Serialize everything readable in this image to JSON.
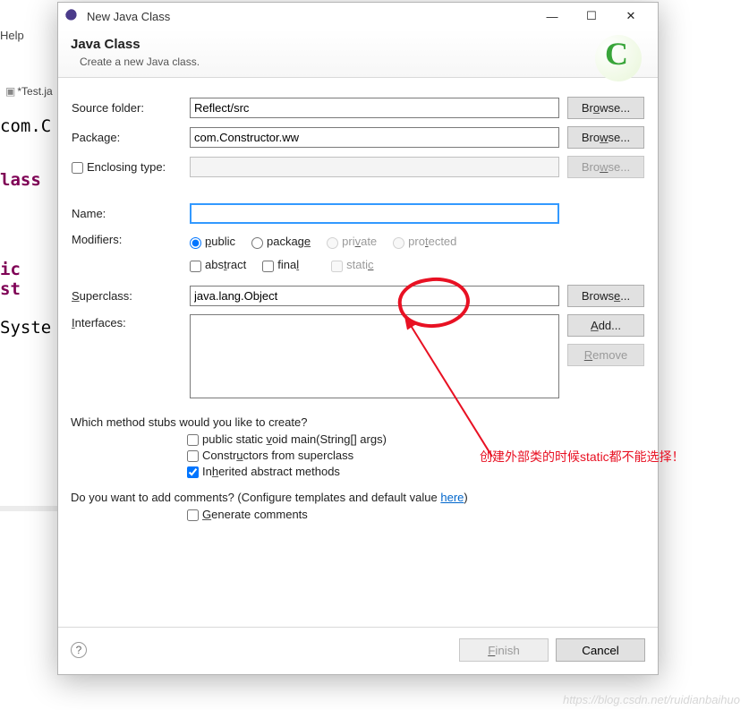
{
  "bg": {
    "help": "Help",
    "tab": "*Test.ja",
    "lines": {
      "pkg": "com.C",
      "cls": "lass",
      "ic": "ic st",
      "sys": "Syste"
    }
  },
  "titlebar": {
    "title": "New Java Class"
  },
  "banner": {
    "heading": "Java Class",
    "sub": "Create a new Java class."
  },
  "labels": {
    "source": "Source folder:",
    "package": "Package:",
    "enclosing": "Enclosing type:",
    "name": "Name:",
    "modifiers": "Modifiers:",
    "superclass": "Superclass:",
    "interfaces": "Interfaces:"
  },
  "values": {
    "source": "Reflect/src",
    "package": "com.Constructor.ww",
    "enclosing": "",
    "name": "",
    "superclass": "java.lang.Object"
  },
  "buttons": {
    "browse": "Browse...",
    "add": "Add...",
    "remove": "Remove",
    "finish": "Finish",
    "cancel": "Cancel"
  },
  "modifiers": {
    "public": "public",
    "package": "package",
    "private": "private",
    "protected": "protected",
    "abstract": "abstract",
    "final": "final",
    "static": "static"
  },
  "stubs": {
    "q": "Which method stubs would you like to create?",
    "main": "public static void main(String[] args)",
    "ctors": "Constructors from superclass",
    "inherited": "Inherited abstract methods"
  },
  "comments": {
    "q1": "Do you want to add comments? (Configure templates and default value ",
    "here": "here",
    "q2": ")",
    "gen": "Generate comments"
  },
  "annotation": "创建外部类的时候static都不能选择！",
  "watermark": "https://blog.csdn.net/ruidianbaihuo"
}
